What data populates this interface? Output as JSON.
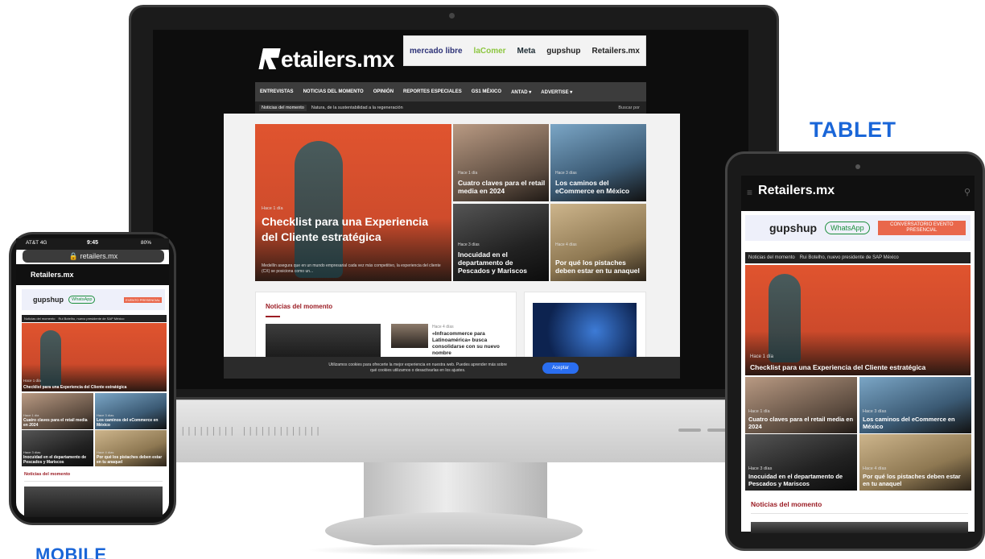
{
  "desktop": {
    "logo": "etailers.mx",
    "banner_items": [
      "mercado libre",
      "laComer",
      "Meta",
      "gupshup",
      "Retailers.mx"
    ],
    "nav": [
      "ENTREVISTAS",
      "NOTICIAS DEL MOMENTO",
      "OPINIÓN",
      "REPORTES ESPECIALES",
      "GS1 MÉXICO",
      "ANTAD ▾",
      "ADVERTISE ▾"
    ],
    "ticker_label": "Noticias del momento",
    "ticker_text": "Natura, de la sustentabilidad a la regeneración",
    "search_label": "Buscar por",
    "hero": {
      "time": "Hace 1 día",
      "title": "Checklist para una Experiencia del Cliente estratégica",
      "desc": "Medellín asegura que en un mundo empresarial cada vez más competitivo, la experiencia del cliente (CX) se posiciona como un..."
    },
    "tiles": [
      {
        "time": "Hace 1 día",
        "title": "Cuatro claves para el retail media en 2024"
      },
      {
        "time": "Hace 3 días",
        "title": "Los caminos del eCommerce en México"
      },
      {
        "time": "Hace 3 días",
        "title": "Inocuidad en el departamento de Pescados y Mariscos"
      },
      {
        "time": "Hace 4 días",
        "title": "Por qué los pistaches deben estar en tu anaquel"
      }
    ],
    "section_title": "Noticias del momento",
    "card_meta": "Hace 4 días",
    "card_text": "«Infracommerce para Latinoamérica» busca consolidarse con su nuevo nombre",
    "cookie_text": "Utilizamos cookies para ofrecerte la mejor experiencia en nuestra web. Puedes aprender más sobre qué cookies utilizamos o desactivarlas en los ajustes.",
    "cookie_button": "Aceptar",
    "chin_vents": "|||||||||  |||||||||||||"
  },
  "tablet": {
    "label": "TABLET",
    "menu_icon": "≡",
    "logo": "etailers.mx",
    "search_icon": "⚲",
    "banner_gupshup": "gupshup",
    "banner_whatsapp": "WhatsApp",
    "banner_conv": "CONVERSATORIO EVENTO PRESENCIAL",
    "ticker_label": "Noticias del momento",
    "ticker_text": "Rui Botelho, nuevo presidente de SAP México",
    "hero_time": "Hace 1 día",
    "hero_title": "Checklist para una Experiencia del Cliente estratégica",
    "tiles": [
      {
        "time": "Hace 1 día",
        "title": "Cuatro claves para el retail media en 2024"
      },
      {
        "time": "Hace 3 días",
        "title": "Los caminos del eCommerce en México"
      },
      {
        "time": "Hace 3 días",
        "title": "Inocuidad en el departamento de Pescados y Mariscos"
      },
      {
        "time": "Hace 4 días",
        "title": "Por qué los pistaches deben estar en tu anaquel"
      }
    ],
    "section_title": "Noticias del momento"
  },
  "mobile": {
    "label": "MOBILE",
    "carrier": "AT&T 4G",
    "time": "9:45",
    "battery": "80%",
    "url": "retailers.mx",
    "logo": "etailers.mx",
    "banner_gupshup": "gupshup",
    "banner_whatsapp": "WhatsApp",
    "banner_conv": "EVENTO PRESENCIAL",
    "ticker_label": "Noticias del momento",
    "ticker_text": "Rui Botelho, nuevo presidente de SAP México",
    "hero_time": "Hace 1 día",
    "hero_title": "Checklist para una Experiencia del Cliente estratégica",
    "tiles": [
      {
        "time": "Hace 1 día",
        "title": "Cuatro claves para el retail media en 2024"
      },
      {
        "time": "Hace 3 días",
        "title": "Los caminos del eCommerce en México"
      },
      {
        "time": "Hace 3 días",
        "title": "Inocuidad en el departamento de Pescados y Mariscos"
      },
      {
        "time": "Hace 4 días",
        "title": "Por qué los pistaches deben estar en tu anaquel"
      }
    ],
    "section_title": "Noticias del momento"
  },
  "colors": {
    "accent_blue": "#1a66d8",
    "brand_red": "#9b1c24",
    "hero_orange": "#e0542f"
  }
}
